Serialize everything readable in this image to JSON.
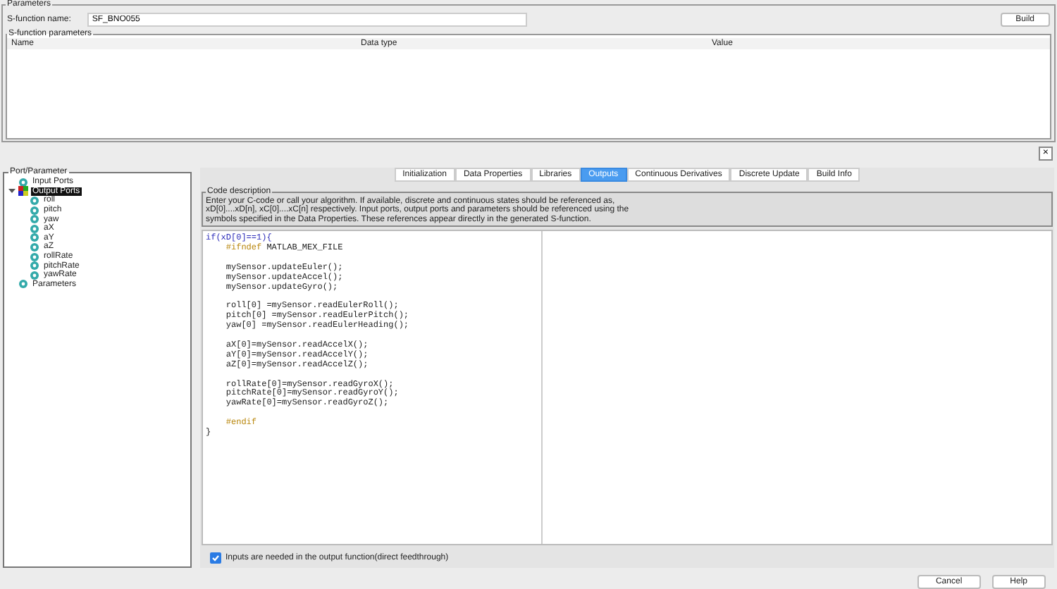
{
  "parameters": {
    "title": "Parameters",
    "name_label": "S-function name:",
    "name_value": "SF_BNO055",
    "build_button": "Build"
  },
  "sfunction_parameters": {
    "title": "S-function parameters",
    "columns": [
      "Name",
      "Data type",
      "Value"
    ],
    "remove_button": "×"
  },
  "port_parameter": {
    "title": "Port/Parameter",
    "items": [
      {
        "label": "Input Ports",
        "selected": false
      },
      {
        "label": "Output Ports",
        "selected": true,
        "expanded": true,
        "children": [
          {
            "label": "roll",
            "selected": false
          },
          {
            "label": "pitch",
            "selected": false
          },
          {
            "label": "yaw",
            "selected": false
          },
          {
            "label": "aX",
            "selected": false
          },
          {
            "label": "aY",
            "selected": false
          },
          {
            "label": "aZ",
            "selected": false
          },
          {
            "label": "rollRate",
            "selected": false
          },
          {
            "label": "pitchRate",
            "selected": false
          },
          {
            "label": "yawRate",
            "selected": false
          }
        ]
      },
      {
        "label": "Parameters",
        "selected": false
      }
    ]
  },
  "tabs": [
    {
      "label": "Initialization",
      "selected": false
    },
    {
      "label": "Data Properties",
      "selected": false
    },
    {
      "label": "Libraries",
      "selected": false
    },
    {
      "label": "Outputs",
      "selected": true
    },
    {
      "label": "Continuous Derivatives",
      "selected": false
    },
    {
      "label": "Discrete Update",
      "selected": false
    },
    {
      "label": "Build Info",
      "selected": false
    }
  ],
  "code_description": {
    "title": "Code description",
    "lines": [
      "Enter your C-code or call your algorithm. If available, discrete and continuous states should be referenced as,",
      "xD[0]....xD[n], xC[0]....xC[n] respectively. Input ports, output ports and parameters should be referenced using the",
      "symbols specified in the Data Properties. These references appear directly in the generated S-function."
    ]
  },
  "code": [
    {
      "kind": "keyword",
      "text": "if(xD[0]==1){"
    },
    {
      "kind": "directive",
      "text": "    #ifndef",
      "rest": " MATLAB_MEX_FILE"
    },
    {
      "kind": "blank"
    },
    {
      "kind": "plain",
      "text": "    mySensor.updateEuler();"
    },
    {
      "kind": "plain",
      "text": "    mySensor.updateAccel();"
    },
    {
      "kind": "plain",
      "text": "    mySensor.updateGyro();"
    },
    {
      "kind": "blank"
    },
    {
      "kind": "plain",
      "text": "    roll[0] =mySensor.readEulerRoll();"
    },
    {
      "kind": "plain",
      "text": "    pitch[0] =mySensor.readEulerPitch();"
    },
    {
      "kind": "plain",
      "text": "    yaw[0] =mySensor.readEulerHeading();"
    },
    {
      "kind": "blank"
    },
    {
      "kind": "plain",
      "text": "    aX[0]=mySensor.readAccelX();"
    },
    {
      "kind": "plain",
      "text": "    aY[0]=mySensor.readAccelY();"
    },
    {
      "kind": "plain",
      "text": "    aZ[0]=mySensor.readAccelZ();"
    },
    {
      "kind": "blank"
    },
    {
      "kind": "plain",
      "text": "    rollRate[0]=mySensor.readGyroX();"
    },
    {
      "kind": "plain",
      "text": "    pitchRate[0]=mySensor.readGyroY();"
    },
    {
      "kind": "plain",
      "text": "    yawRate[0]=mySensor.readGyroZ();"
    },
    {
      "kind": "blank"
    },
    {
      "kind": "directive",
      "text": "    #endif"
    },
    {
      "kind": "plain",
      "text": "}"
    }
  ],
  "direct_feedthrough": {
    "label": "Inputs are needed in the output function(direct feedthrough)",
    "checked": true
  },
  "buttons": [
    "Cancel",
    "Help"
  ]
}
